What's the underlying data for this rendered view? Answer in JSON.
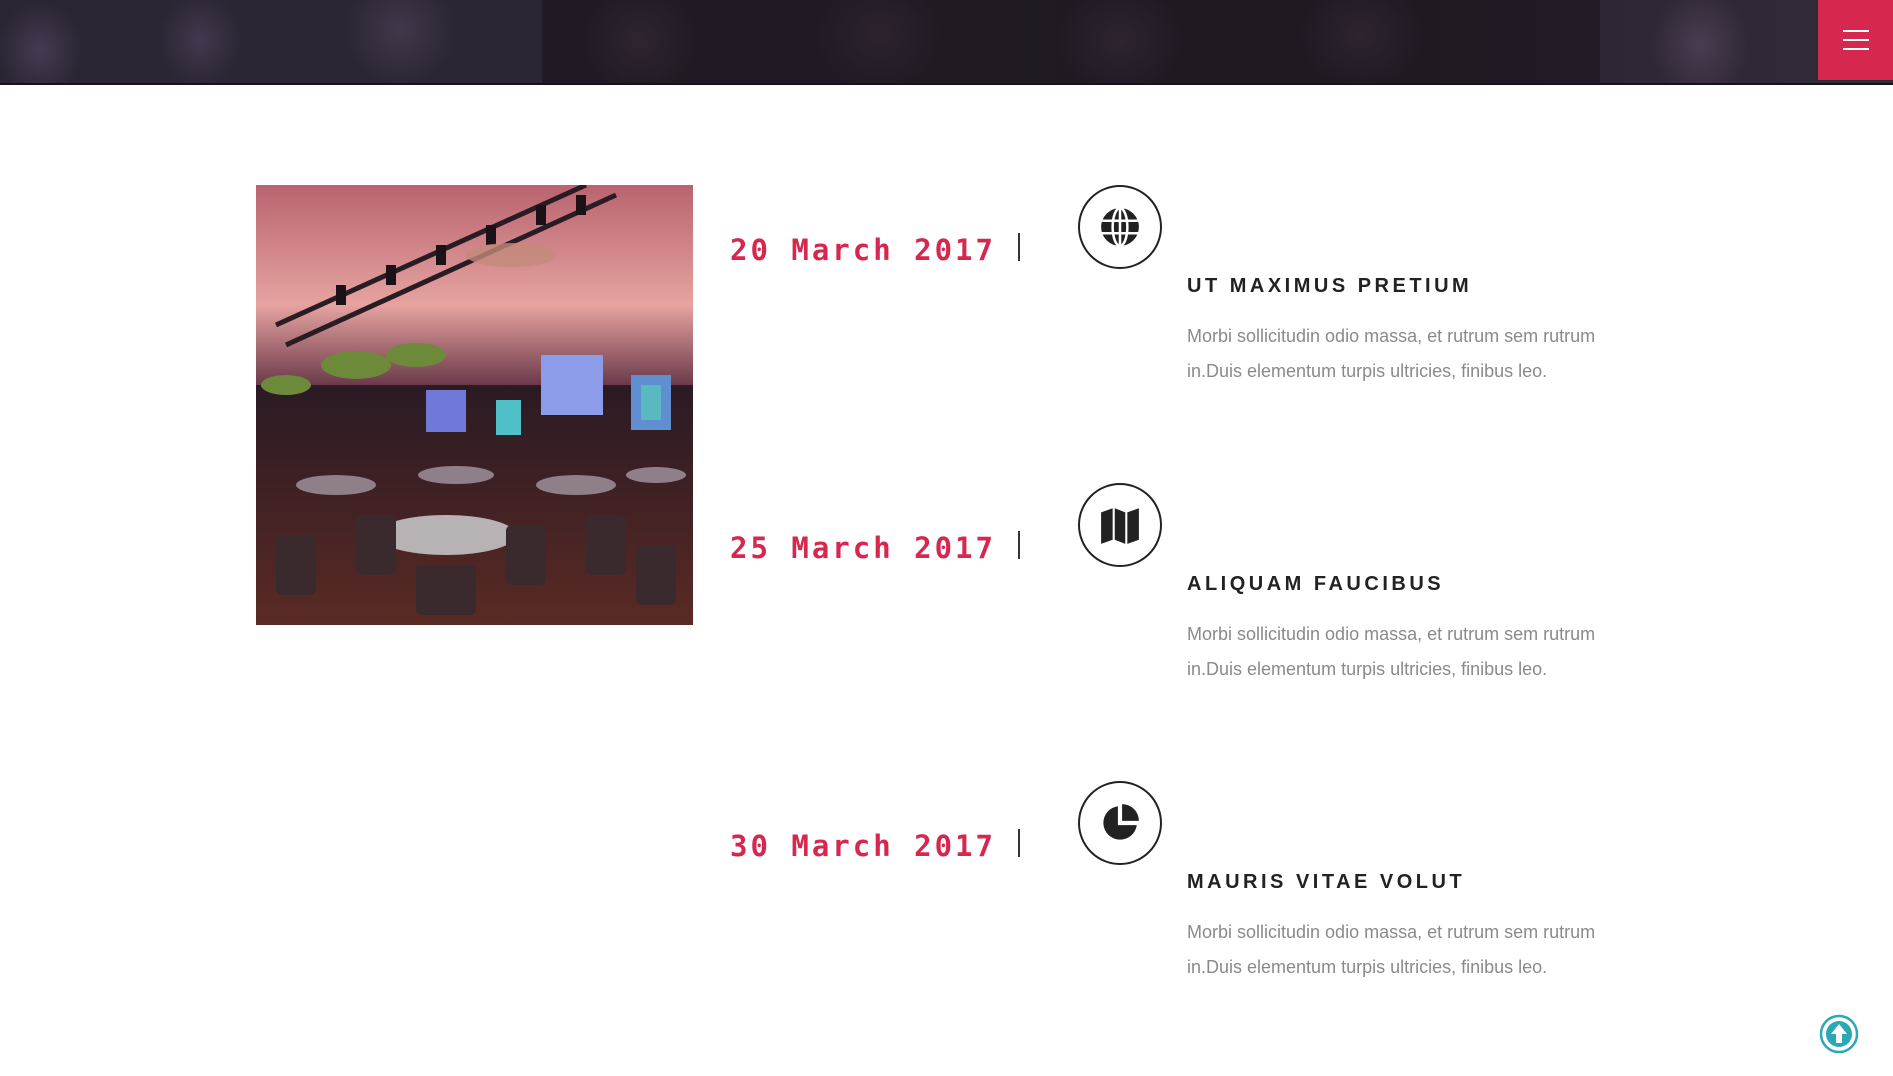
{
  "header": {
    "menu_icon": "hamburger-menu-icon",
    "accent_color": "#d6284f"
  },
  "timeline": {
    "items": [
      {
        "date": "20 March 2017",
        "icon": "globe-icon",
        "title": "UT MAXIMUS PRETIUM",
        "description": "Morbi sollicitudin odio massa, et rutrum sem rutrum in.Duis elementum turpis ultricies, finibus leo."
      },
      {
        "date": "25 March 2017",
        "icon": "map-icon",
        "title": "ALIQUAM FAUCIBUS",
        "description": "Morbi sollicitudin odio massa, et rutrum sem rutrum in.Duis elementum turpis ultricies, finibus leo."
      },
      {
        "date": "30 March 2017",
        "icon": "pie-chart-icon",
        "title": "MAURIS VITAE VOLUT",
        "description": "Morbi sollicitudin odio massa, et rutrum sem rutrum in.Duis elementum turpis ultricies, finibus leo."
      }
    ]
  },
  "footer": {
    "back_to_top_icon": "arrow-up-circle-icon",
    "back_to_top_color": "#2aa8b4"
  }
}
